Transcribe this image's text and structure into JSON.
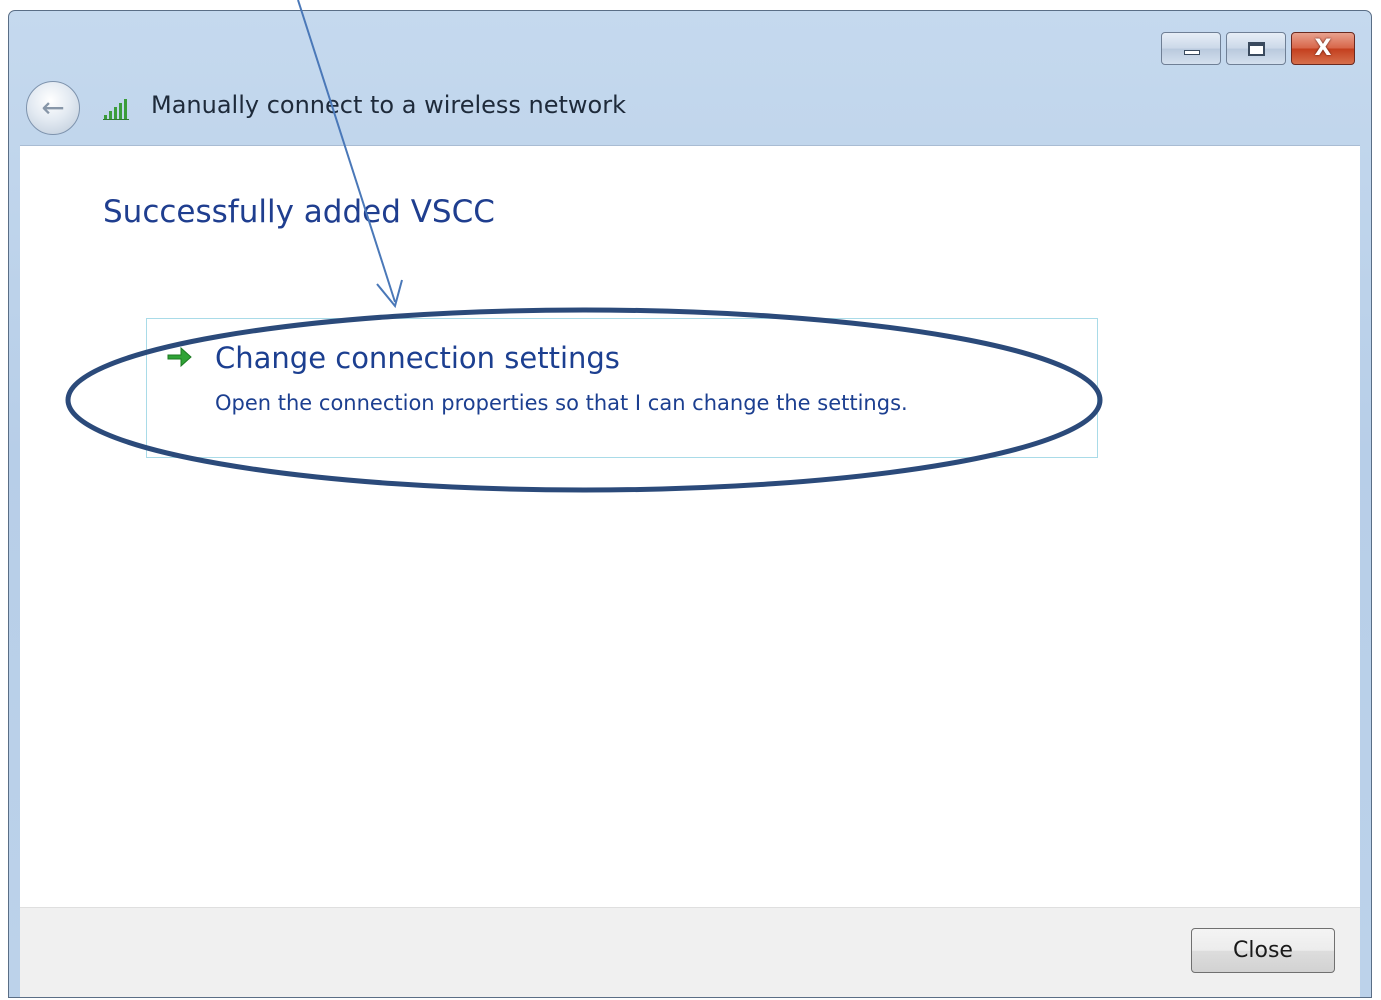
{
  "window": {
    "title": "Manually connect to a wireless network",
    "caption_buttons": {
      "minimize_icon": "minimize-icon",
      "maximize_icon": "maximize-icon",
      "close_glyph": "X"
    },
    "back_icon": "back-arrow-icon",
    "network_icon": "wireless-signal-icon"
  },
  "content": {
    "heading": "Successfully added VSCC",
    "option": {
      "icon": "green-arrow-icon",
      "title": "Change connection settings",
      "description": "Open the connection properties so that I can change the settings."
    }
  },
  "footer": {
    "close_label": "Close"
  },
  "colors": {
    "heading": "#1f3e8f",
    "annotation": "#2b4a7a",
    "arrow_green": "#2fa336"
  }
}
